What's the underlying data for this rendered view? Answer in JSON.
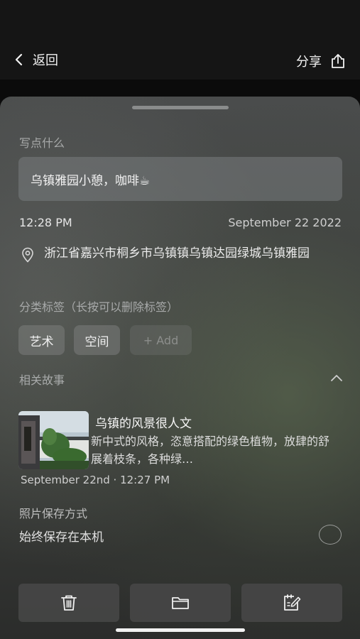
{
  "header": {
    "back_label": "返回",
    "share_label": "分享"
  },
  "note": {
    "section_label": "写点什么",
    "text": "乌镇雅园小憩，咖啡☕",
    "time": "12:28 PM",
    "date": "September 22 2022",
    "address": "浙江省嘉兴市桐乡市乌镇镇乌镇达园绿城乌镇雅园"
  },
  "tags": {
    "section_label": "分类标签（长按可以删除标签）",
    "items": [
      "艺术",
      "空间"
    ],
    "add_label": "+ Add"
  },
  "related": {
    "section_label": "相关故事",
    "story": {
      "title": "乌镇的风景很人文",
      "excerpt": "新中式的风格，恣意搭配的绿色植物，放肆的舒展着枝条，各种绿…",
      "meta": "September 22nd · 12:27 PM"
    }
  },
  "photo_save": {
    "section_label": "照片保存方式",
    "option_label": "始终保存在本机",
    "selected": false
  },
  "icons": {
    "back": "chevron-left-icon",
    "share": "share-icon",
    "location": "location-pin-icon",
    "collapse": "chevron-up-icon",
    "delete": "trash-icon",
    "folder": "folder-icon",
    "edit": "edit-note-icon"
  }
}
